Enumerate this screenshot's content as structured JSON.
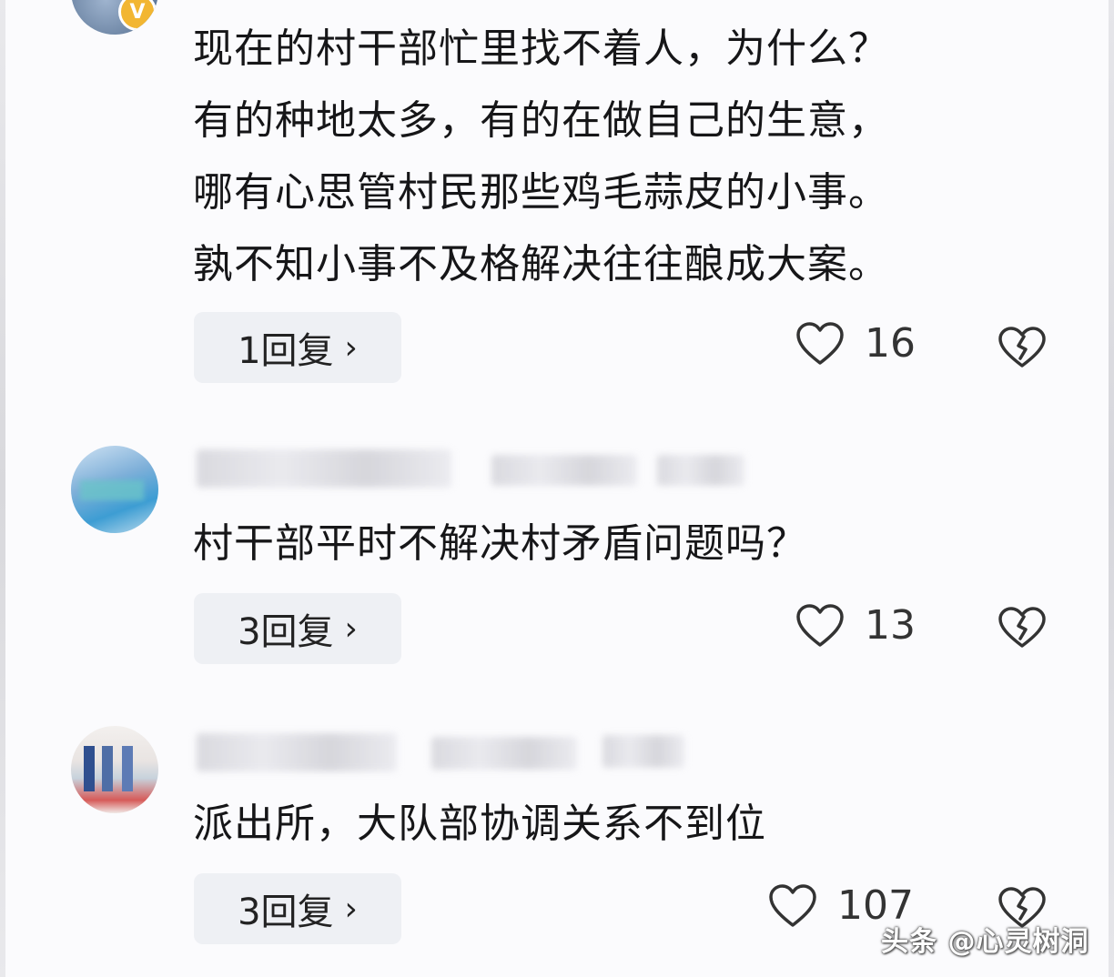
{
  "comments": [
    {
      "text": "现在的村干部忙里找不着人，为什么？\n有的种地太多，有的在做自己的生意，\n哪有心思管村民那些鸡毛蒜皮的小事。\n孰不知小事不及格解决往往酿成大案。",
      "reply_label": "1回复",
      "likes": "16",
      "verified_badge": "V"
    },
    {
      "text": "村干部平时不解决村矛盾问题吗？",
      "reply_label": "3回复",
      "likes": "13"
    },
    {
      "text": "派出所，大队部协调关系不到位",
      "reply_label": "3回复",
      "likes": "107"
    }
  ],
  "icons": {
    "like": "heart-outline-icon",
    "dislike": "broken-heart-icon",
    "chevron": "chevron-right-icon"
  },
  "chevron_glyph": "›",
  "watermark": "头条 @心灵树洞",
  "colors": {
    "background": "#fbfbfd",
    "reply_button_bg": "#eef0f4",
    "text": "#161618",
    "icon": "#333333"
  }
}
